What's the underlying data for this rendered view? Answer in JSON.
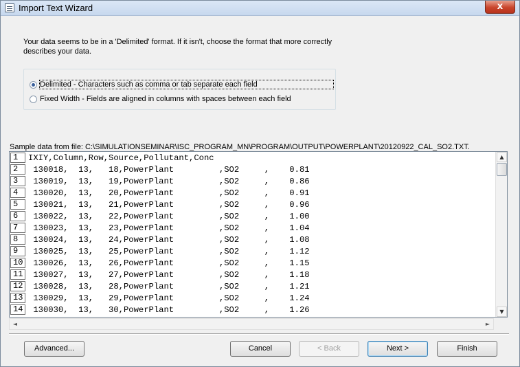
{
  "window": {
    "title": "Import Text Wizard",
    "close_glyph": "x"
  },
  "intro_text": "Your data seems to be in a 'Delimited' format. If it isn't, choose the format that more correctly describes your data.",
  "options": [
    {
      "label": "Delimited - Characters such as comma or tab separate each field",
      "checked": true
    },
    {
      "label": "Fixed Width - Fields are aligned in columns with spaces between each field",
      "checked": false
    }
  ],
  "sample_label": "Sample data from file: C:\\SIMULATIONSEMINAR\\ISC_PROGRAM_MN\\PROGRAM\\OUTPUT\\POWERPLANT\\20120922_CAL_SO2.TXT.",
  "rows": [
    {
      "num": "1",
      "text": "IXIY,Column,Row,Source,Pollutant,Conc"
    },
    {
      "num": "2",
      "text": " 130018,  13,   18,PowerPlant         ,SO2     ,    0.81"
    },
    {
      "num": "3",
      "text": " 130019,  13,   19,PowerPlant         ,SO2     ,    0.86"
    },
    {
      "num": "4",
      "text": " 130020,  13,   20,PowerPlant         ,SO2     ,    0.91"
    },
    {
      "num": "5",
      "text": " 130021,  13,   21,PowerPlant         ,SO2     ,    0.96"
    },
    {
      "num": "6",
      "text": " 130022,  13,   22,PowerPlant         ,SO2     ,    1.00"
    },
    {
      "num": "7",
      "text": " 130023,  13,   23,PowerPlant         ,SO2     ,    1.04"
    },
    {
      "num": "8",
      "text": " 130024,  13,   24,PowerPlant         ,SO2     ,    1.08"
    },
    {
      "num": "9",
      "text": " 130025,  13,   25,PowerPlant         ,SO2     ,    1.12"
    },
    {
      "num": "10",
      "text": " 130026,  13,   26,PowerPlant         ,SO2     ,    1.15"
    },
    {
      "num": "11",
      "text": " 130027,  13,   27,PowerPlant         ,SO2     ,    1.18"
    },
    {
      "num": "12",
      "text": " 130028,  13,   28,PowerPlant         ,SO2     ,    1.21"
    },
    {
      "num": "13",
      "text": " 130029,  13,   29,PowerPlant         ,SO2     ,    1.24"
    },
    {
      "num": "14",
      "text": " 130030,  13,   30,PowerPlant         ,SO2     ,    1.26"
    }
  ],
  "buttons": {
    "advanced": "Advanced...",
    "cancel": "Cancel",
    "back": "< Back",
    "next": "Next >",
    "finish": "Finish"
  },
  "icons": {
    "scroll_up": "▲",
    "scroll_down": "▼",
    "scroll_left": "◄",
    "scroll_right": "►"
  }
}
